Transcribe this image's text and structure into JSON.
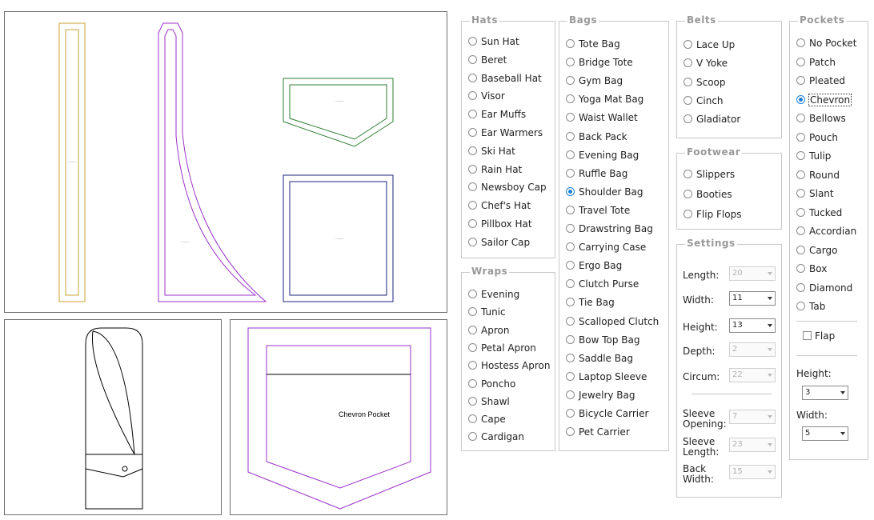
{
  "preview": {
    "pattern_labels": [
      "cutting line",
      "cutting line",
      "cutting line",
      "cutting line"
    ],
    "pocket_label": "Chevron Pocket"
  },
  "hats": {
    "legend": "Hats",
    "items": [
      "Sun Hat",
      "Beret",
      "Baseball Hat",
      "Visor",
      "Ear Muffs",
      "Ear Warmers",
      "Ski Hat",
      "Rain Hat",
      "Newsboy Cap",
      "Chef's Hat",
      "Pillbox Hat",
      "Sailor Cap"
    ]
  },
  "wraps": {
    "legend": "Wraps",
    "items": [
      "Evening",
      "Tunic",
      "Apron",
      "Petal Apron",
      "Hostess Apron",
      "Poncho",
      "Shawl",
      "Cape",
      "Cardigan"
    ]
  },
  "bags": {
    "legend": "Bags",
    "selected": "Shoulder Bag",
    "items": [
      "Tote Bag",
      "Bridge Tote",
      "Gym Bag",
      "Yoga Mat Bag",
      "Waist Wallet",
      "Back Pack",
      "Evening Bag",
      "Ruffle Bag",
      "Shoulder Bag",
      "Travel Tote",
      "Drawstring Bag",
      "Carrying Case",
      "Ergo Bag",
      "Clutch Purse",
      "Tie Bag",
      "Scalloped Clutch",
      "Bow Top Bag",
      "Saddle Bag",
      "Laptop Sleeve",
      "Jewelry Bag",
      "Bicycle Carrier",
      "Pet Carrier"
    ]
  },
  "belts": {
    "legend": "Belts",
    "items": [
      "Lace Up",
      "V Yoke",
      "Scoop",
      "Cinch",
      "Gladiator"
    ]
  },
  "footwear": {
    "legend": "Footwear",
    "items": [
      "Slippers",
      "Booties",
      "Flip Flops"
    ]
  },
  "settings": {
    "legend": "Settings",
    "rows": [
      {
        "label": "Length:",
        "value": "20",
        "disabled": true
      },
      {
        "label": "Width:",
        "value": "11",
        "disabled": false
      },
      {
        "label": "Height:",
        "value": "13",
        "disabled": false
      },
      {
        "label": "Depth:",
        "value": "2",
        "disabled": true
      },
      {
        "label": "Circum:",
        "value": "22",
        "disabled": true
      }
    ],
    "sleeve_rows": [
      {
        "label": "Sleeve Opening:",
        "value": "7",
        "disabled": true
      },
      {
        "label": "Sleeve Length:",
        "value": "23",
        "disabled": true
      },
      {
        "label": "Back Width:",
        "value": "15",
        "disabled": true
      }
    ]
  },
  "pockets": {
    "legend": "Pockets",
    "selected": "Chevron",
    "items": [
      "No Pocket",
      "Patch",
      "Pleated",
      "Chevron",
      "Bellows",
      "Pouch",
      "Tulip",
      "Round",
      "Slant",
      "Tucked",
      "Accordian",
      "Cargo",
      "Box",
      "Diamond",
      "Tab"
    ],
    "flap_label": "Flap",
    "height_label": "Height:",
    "height_value": "3",
    "width_label": "Width:",
    "width_value": "5"
  },
  "colors": {
    "strap": "#c8a030",
    "body": "#9b30c8",
    "chevron_pattern": "#2e7d32",
    "rect_pattern": "#1a237e",
    "selected_radio": "#1a7fd9"
  }
}
